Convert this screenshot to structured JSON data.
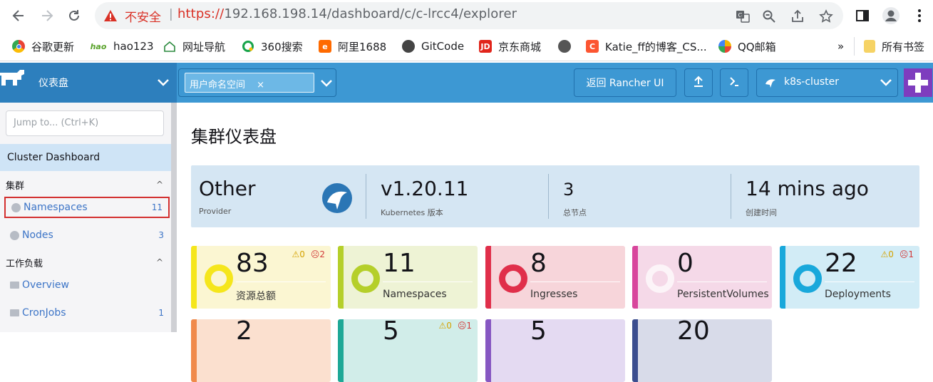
{
  "browser": {
    "insecure_label": "不安全",
    "url_scheme": "https://",
    "url_rest": "192.168.198.14/dashboard/c/c-lrcc4/explorer",
    "bookmarks": [
      {
        "label": "谷歌更新",
        "color": "#ea4335"
      },
      {
        "label": "hao123",
        "color": "#5aa32c"
      },
      {
        "label": "网址导航",
        "color": "#2b8a3e"
      },
      {
        "label": "360搜索",
        "color": "#16a34a"
      },
      {
        "label": "阿里1688",
        "color": "#ff6a00"
      },
      {
        "label": "GitCode",
        "color": "#444444"
      },
      {
        "label": "京东商城",
        "color": "#e1251b"
      },
      {
        "label": "",
        "color": "#555555"
      },
      {
        "label": "Katie_ff的博客_CS...",
        "color": "#fc5531"
      },
      {
        "label": "QQ邮箱",
        "color": "#f5b400"
      }
    ],
    "more": "»",
    "all_bookmarks": "所有书签"
  },
  "header": {
    "title": "仪表盘",
    "namespace_chip": "用户命名空间",
    "chip_close": "×",
    "back_button": "返回 Rancher UI",
    "cluster_name": "k8s-cluster",
    "accent": "#3d98d3"
  },
  "sidebar": {
    "jump_placeholder": "Jump to... (Ctrl+K)",
    "cluster_dashboard": "Cluster Dashboard",
    "group_cluster": "集群",
    "namespaces_label": "Namespaces",
    "namespaces_count": "11",
    "nodes_label": "Nodes",
    "nodes_count": "3",
    "group_workloads": "工作负载",
    "overview_label": "Overview",
    "cronjobs_label": "CronJobs",
    "cronjobs_count": "1"
  },
  "main": {
    "page_title": "集群仪表盘",
    "info": {
      "provider_value": "Other",
      "provider_label": "Provider",
      "k8s_value": "v1.20.11",
      "k8s_label": "Kubernetes 版本",
      "nodes_value": "3",
      "nodes_label": "总节点",
      "created_value": "14 mins ago",
      "created_label": "创建时间"
    },
    "cards": [
      {
        "count": "83",
        "name": "资源总额",
        "warn": "⚠0",
        "err": "☹2",
        "color": "#f5e61c",
        "bg": "#fbf6d2"
      },
      {
        "count": "11",
        "name": "Namespaces",
        "warn": "",
        "err": "",
        "color": "#b5cf2a",
        "bg": "#eef3d5"
      },
      {
        "count": "8",
        "name": "Ingresses",
        "warn": "",
        "err": "",
        "color": "#e02f4a",
        "bg": "#f7d5da"
      },
      {
        "count": "0",
        "name": "PersistentVolumes",
        "warn": "",
        "err": "",
        "color": "#d8469c",
        "bg": "#f5d9e8"
      },
      {
        "count": "22",
        "name": "Deployments",
        "warn": "⚠0",
        "err": "☹1",
        "color": "#19a8db",
        "bg": "#d2ecf6"
      }
    ],
    "row2": [
      {
        "count": "2",
        "warn": "",
        "err": "",
        "color": "#f08a4b",
        "bg": "#fbe0cf"
      },
      {
        "count": "5",
        "warn": "⚠0",
        "err": "☹1",
        "color": "#1ea896",
        "bg": "#d1ede9"
      },
      {
        "count": "5",
        "warn": "",
        "err": "",
        "color": "#8657c2",
        "bg": "#e4daf2"
      },
      {
        "count": "20",
        "warn": "",
        "err": "",
        "color": "#3b4d8f",
        "bg": "#d8dbe9"
      }
    ]
  }
}
